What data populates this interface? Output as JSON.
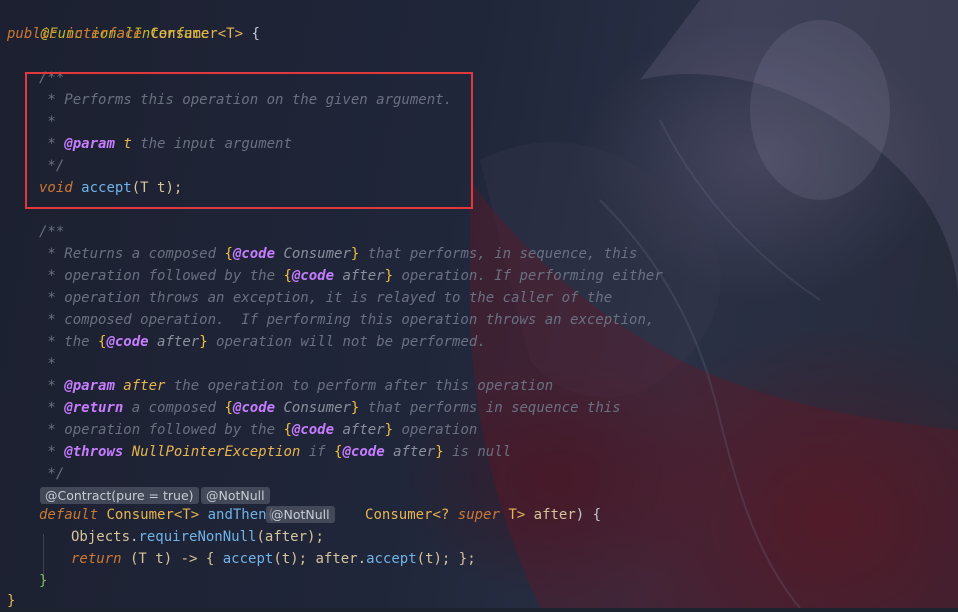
{
  "editor": {
    "lines": {
      "l1": {
        "annotation": "@FunctionalInterface"
      },
      "l2": {
        "kw1": "public",
        "kw2": "interface",
        "type": "Consumer<T>",
        "brace": "{"
      },
      "l3": {
        "text": "/**"
      },
      "l4": {
        "text": " * Performs this operation on the given argument."
      },
      "l5": {
        "text": " *"
      },
      "l6": {
        "star": " * ",
        "tag": "@param",
        "name": "t",
        "desc": "the input argument"
      },
      "l7": {
        "text": " */"
      },
      "l8": {
        "kw": "void",
        "method": "accept",
        "params": "(T t);"
      },
      "l9": {
        "text": "/**"
      },
      "l10": {
        "a": " * Returns a composed ",
        "b1": "{",
        "tag": "@code",
        "ref": " Consumer",
        "b2": "}",
        "c": " that performs, in sequence, this"
      },
      "l11": {
        "a": " * operation followed by the ",
        "b1": "{",
        "tag": "@code",
        "ref": " after",
        "b2": "}",
        "c": " operation. If performing either"
      },
      "l12": {
        "text": " * operation throws an exception, it is relayed to the caller of the"
      },
      "l13": {
        "text": " * composed operation.  If performing this operation throws an exception,"
      },
      "l14": {
        "a": " * the ",
        "b1": "{",
        "tag": "@code",
        "ref": " after",
        "b2": "}",
        "c": " operation will not be performed."
      },
      "l15": {
        "text": " *"
      },
      "l16": {
        "star": " * ",
        "tag": "@param",
        "name": " after",
        "desc": " the operation to perform after this operation"
      },
      "l17": {
        "star": " * ",
        "tag": "@return",
        "a": " a composed ",
        "b1": "{",
        "tag2": "@code",
        "ref": " Consumer",
        "b2": "}",
        "c": " that performs in sequence this"
      },
      "l18": {
        "a": " * operation followed by the ",
        "b1": "{",
        "tag": "@code",
        "ref": " after",
        "b2": "}",
        "c": " operation"
      },
      "l19": {
        "star": " * ",
        "tag": "@throws",
        "name": " NullPointerException",
        "a": " if ",
        "b1": "{",
        "tag2": "@code",
        "ref": " after",
        "b2": "}",
        "c": " is null"
      },
      "l20": {
        "text": " */"
      },
      "l21": {
        "kw": "default",
        "type": " Consumer<T> ",
        "method": "andThen",
        "open": "(",
        "type2": "Consumer<? ",
        "kw2": "super",
        "type3": " T> ",
        "param": "after",
        "close": ") ",
        "brace": "{"
      },
      "l22": {
        "obj": "Objects",
        "dot": ".",
        "method": "requireNonNull",
        "args": "(after);"
      },
      "l23": {
        "kw": "return",
        "a": " (T t) -> { ",
        "m1": "accept",
        "b": "(t); ",
        "obj": "after",
        "dot": ".",
        "m2": "accept",
        "c": "(t); };"
      },
      "l24": {
        "brace": "}"
      },
      "l25": {
        "brace": "}"
      }
    },
    "hints": {
      "contract": "@Contract(pure = true)",
      "notnull_method": "@NotNull",
      "notnull_param": "@NotNull"
    }
  },
  "colors": {
    "highlight_border": "#e0383c",
    "keyword": "#cc7832",
    "annotation": "#bbb529",
    "javadoc_tag": "#c77dff",
    "comment": "#6a7080",
    "method": "#6fb3e8"
  }
}
